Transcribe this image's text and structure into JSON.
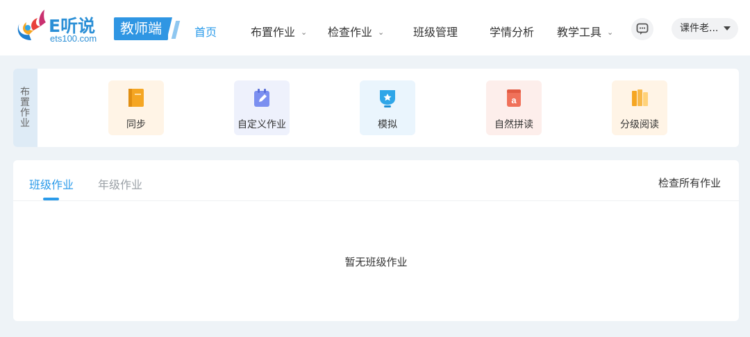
{
  "header": {
    "logo": {
      "brand": "E听说",
      "url": "ets100.com",
      "badge": "教师端"
    },
    "nav": [
      {
        "label": "首页",
        "active": true,
        "has_dropdown": false
      },
      {
        "label": "布置作业",
        "active": false,
        "has_dropdown": true
      },
      {
        "label": "检查作业",
        "active": false,
        "has_dropdown": true
      },
      {
        "label": "班级管理",
        "active": false,
        "has_dropdown": false
      },
      {
        "label": "学情分析",
        "active": false,
        "has_dropdown": false
      },
      {
        "label": "教学工具",
        "active": false,
        "has_dropdown": true
      }
    ],
    "chat_icon": "message-icon",
    "user": {
      "label": "课件老...",
      "icon": "caret-down-icon"
    }
  },
  "assign": {
    "side_label": "布置作业",
    "tiles": [
      {
        "label": "同步",
        "icon": "book-icon",
        "bg": "#fff4e6",
        "color": "#f5a623"
      },
      {
        "label": "自定义作业",
        "icon": "edit-calendar-icon",
        "bg": "#eef1fc",
        "color": "#7b8ff0"
      },
      {
        "label": "模拟",
        "icon": "badge-icon",
        "bg": "#eaf5fd",
        "color": "#2fa6e8"
      },
      {
        "label": "自然拼读",
        "icon": "letter-a-icon",
        "bg": "#fdeeeb",
        "color": "#f0715a"
      },
      {
        "label": "分级阅读",
        "icon": "books-icon",
        "bg": "#fff4e6",
        "color": "#f5a623"
      }
    ]
  },
  "homework": {
    "tabs": [
      {
        "label": "班级作业",
        "active": true
      },
      {
        "label": "年级作业",
        "active": false
      }
    ],
    "check_all": "检查所有作业",
    "empty": "暂无班级作业"
  },
  "colors": {
    "accent": "#2b9bea",
    "page_bg": "#eef3f7",
    "brand_blue": "#2f96e3"
  }
}
